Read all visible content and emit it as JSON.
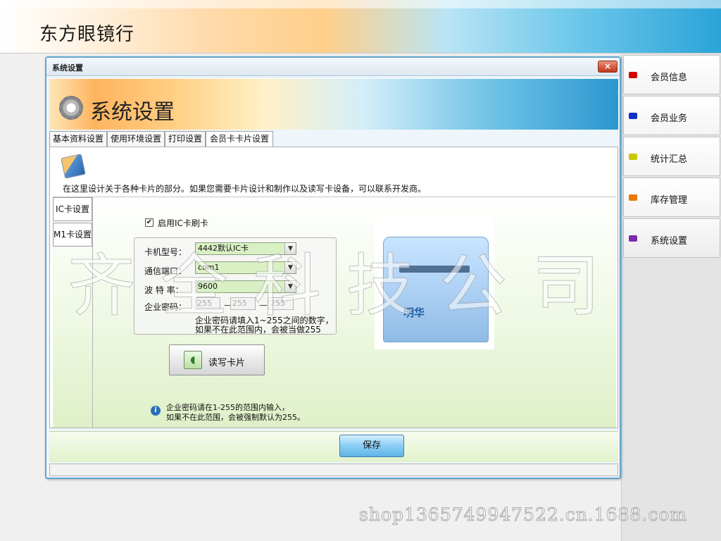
{
  "app": {
    "title": "东方眼镜行"
  },
  "sidebar": {
    "items": [
      {
        "label": "会员信息",
        "color": "#d40000"
      },
      {
        "label": "会员业务",
        "color": "#1030c8"
      },
      {
        "label": "统计汇总",
        "color": "#c8c800"
      },
      {
        "label": "库存管理",
        "color": "#e87a00"
      },
      {
        "label": "系统设置",
        "color": "#7a2ca8"
      }
    ]
  },
  "dialog": {
    "title": "系统设置",
    "close_label": "×",
    "banner_title": "系统设置",
    "tabs": [
      "基本资料设置",
      "使用环境设置",
      "打印设置",
      "会员卡卡片设置"
    ],
    "description": "在这里设计关于各种卡片的部分。如果您需要卡片设计和制作以及读写卡设备，可以联系开发商。",
    "side_tabs": [
      "IC卡设置",
      "M1卡设置"
    ],
    "ic": {
      "enable_label": "启用IC卡刷卡",
      "enable_checked": true,
      "card_model_label": "卡机型号：",
      "card_model_value": "4442默认IC卡",
      "port_label": "通信端口：",
      "port_value": "com1",
      "baud_label": "波 特 率：",
      "baud_value": "9600",
      "password_label": "企业密码：",
      "password_values": [
        "255",
        "255",
        "255"
      ],
      "password_note_1": "企业密码请填入1~255之间的数字，",
      "password_note_2": "如果不在此范围内，会被当做255",
      "read_write_button": "读写卡片",
      "info_1": "企业密码请在1-255的范围内输入，",
      "info_2": "如果不在此范围，会被强制默认为255。"
    },
    "reader_brand": "明华",
    "save_button": "保存"
  },
  "watermark": "齐全科技公司",
  "shop_watermark": "shop1365749947522.cn.1688.com"
}
